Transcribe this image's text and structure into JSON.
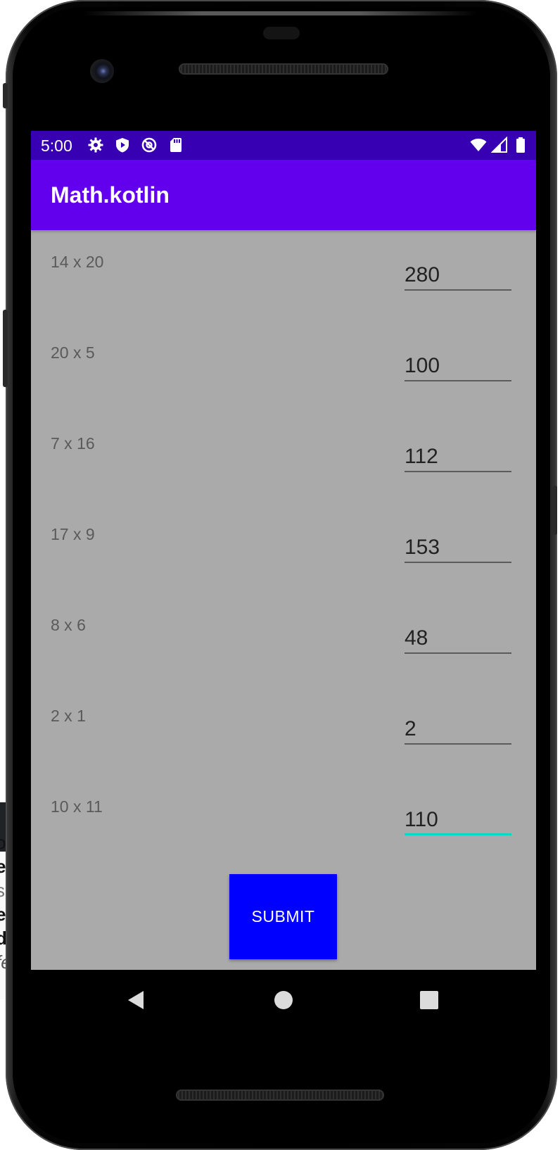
{
  "status_bar": {
    "time": "5:00",
    "left_icons": [
      "settings-icon",
      "shield-icon",
      "sync-icon",
      "sd-card-icon"
    ],
    "right_icons": [
      "wifi-icon",
      "signal-icon",
      "battery-icon"
    ]
  },
  "app_bar": {
    "title": "Math.kotlin"
  },
  "problems": [
    {
      "question": "14 x 20",
      "answer": "280"
    },
    {
      "question": "20 x 5",
      "answer": "100"
    },
    {
      "question": "7 x 16",
      "answer": "112"
    },
    {
      "question": "17 x 9",
      "answer": "153"
    },
    {
      "question": "8 x 6",
      "answer": "48"
    },
    {
      "question": "2 x 1",
      "answer": "2"
    },
    {
      "question": "10 x 11",
      "answer": "110"
    }
  ],
  "submit_label": "SUBMIT",
  "nav_bar": {
    "icons": [
      "back-icon",
      "home-icon",
      "recents-icon"
    ]
  },
  "colors": {
    "status_bar": "#3700b3",
    "app_bar": "#6200ee",
    "background": "#aaaaaa",
    "submit_button": "#0000ff",
    "focus_underline": "#03dac5"
  }
}
